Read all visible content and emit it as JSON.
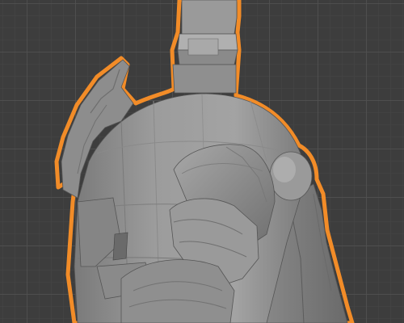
{
  "viewport": {
    "background_color": "#3d3d3d",
    "grid_color": "#505050",
    "selection_outline_color": "#f28c28",
    "mesh_color": "#8e8e8e",
    "selected_object": "knight-armor-model"
  }
}
